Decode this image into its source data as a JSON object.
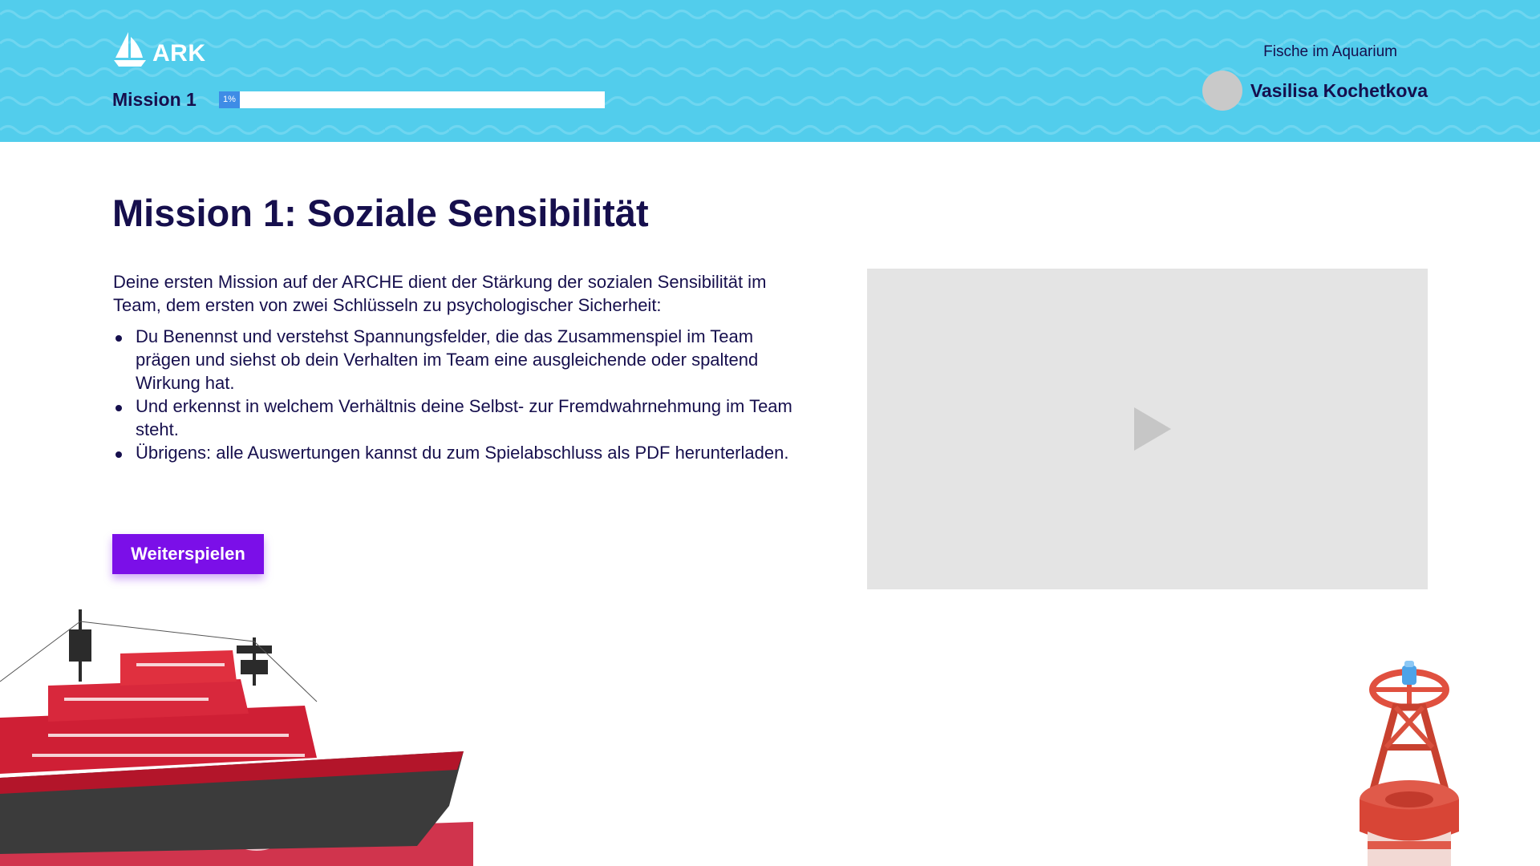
{
  "header": {
    "logo_text": "ARK",
    "mission_label": "Mission 1",
    "progress": {
      "value": 1,
      "label": "1%"
    },
    "game_name": "Fische im Aquarium",
    "user_name": "Vasilisa Kochetkova",
    "colors": {
      "background": "#52cdec",
      "progress": "#3e8ce6",
      "text": "#160f4d"
    }
  },
  "main": {
    "title": "Mission 1: Soziale Sensibilität",
    "intro": "Deine ersten Mission auf der ARCHE dient der Stärkung der sozialen Sensibilität im Team, dem ersten von zwei Schlüsseln zu psychologischer Sicherheit:",
    "bullets": [
      "Du Benennst und verstehst Spannungsfelder, die das Zusammenspiel im Team prägen und siehst ob dein Verhalten im Team eine ausgleichende oder spaltend Wirkung hat.",
      "Und erkennst in welchem Verhältnis deine Selbst- zur Fremdwahrnehmung im Team steht.",
      "Übrigens: alle Auswertungen kannst du zum Spielabschluss als PDF herunterladen."
    ],
    "cta_label": "Weiterspielen",
    "cta_color": "#7b0fe8",
    "video": {
      "icon": "play-icon"
    }
  },
  "decor": {
    "left_image": "icebreaker-ship",
    "right_image": "red-buoy"
  }
}
